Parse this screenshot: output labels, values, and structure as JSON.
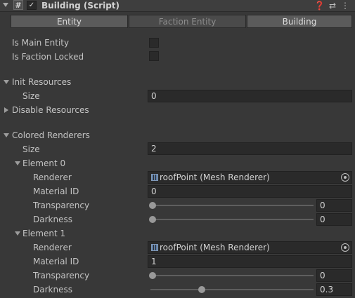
{
  "header": {
    "script_icon": "#",
    "enabled": true,
    "title": "Building (Script)",
    "icons": [
      "help-icon",
      "preset-icon",
      "more-menu-icon"
    ]
  },
  "tabs": [
    {
      "label": "Entity",
      "active": true
    },
    {
      "label": "Faction Entity",
      "active": false
    },
    {
      "label": "Building",
      "active": true
    }
  ],
  "fields": {
    "is_main_entity": {
      "label": "Is Main Entity",
      "value": false
    },
    "is_faction_locked": {
      "label": "Is Faction Locked",
      "value": false
    },
    "init_resources": {
      "label": "Init Resources",
      "expanded": true,
      "size_label": "Size",
      "size": "0"
    },
    "disable_resources": {
      "label": "Disable Resources",
      "expanded": false
    },
    "colored_renderers": {
      "label": "Colored Renderers",
      "expanded": true,
      "size_label": "Size",
      "size": "2",
      "elements": [
        {
          "label": "Element 0",
          "renderer_label": "Renderer",
          "renderer": "roofPoint (Mesh Renderer)",
          "material_label": "Material ID",
          "material": "0",
          "transparency_label": "Transparency",
          "transparency": "0",
          "transparency_fraction": 0,
          "darkness_label": "Darkness",
          "darkness": "0",
          "darkness_fraction": 0
        },
        {
          "label": "Element 1",
          "renderer_label": "Renderer",
          "renderer": "roofPoint (Mesh Renderer)",
          "material_label": "Material ID",
          "material": "1",
          "transparency_label": "Transparency",
          "transparency": "0",
          "transparency_fraction": 0,
          "darkness_label": "Darkness",
          "darkness": "0.3",
          "darkness_fraction": 0.3
        }
      ]
    }
  },
  "colors": {
    "background": "#383838",
    "field": "#2a2a2a",
    "tab_active": "#5b5b5b",
    "tab_inactive": "#4a4a4a"
  }
}
